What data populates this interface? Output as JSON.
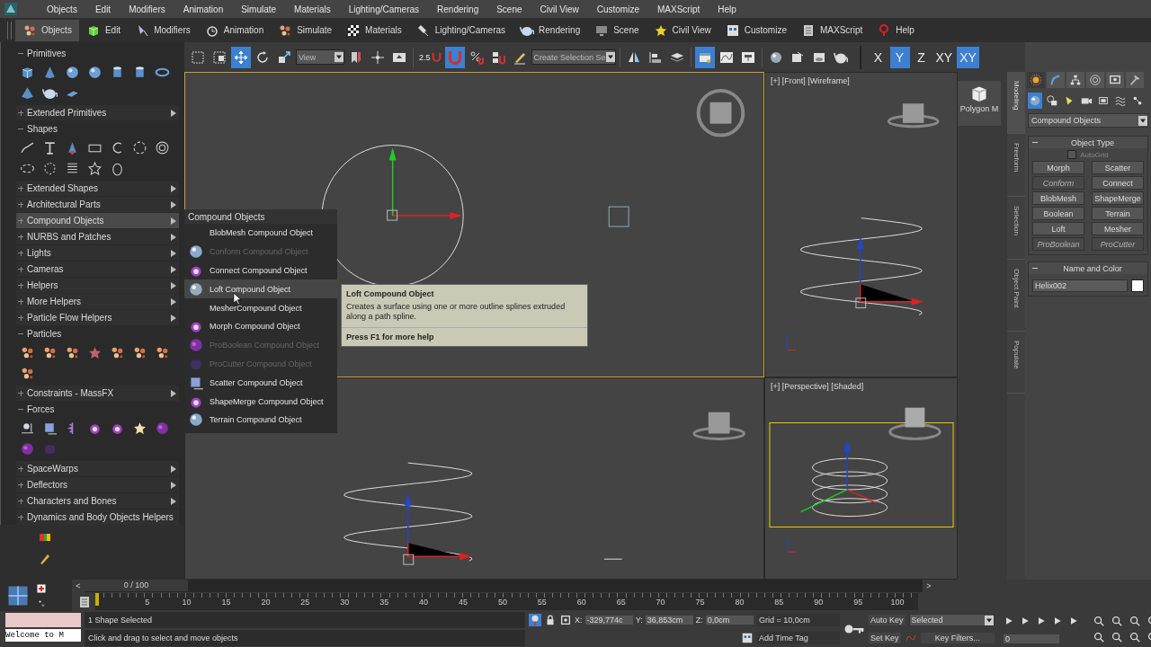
{
  "menu": [
    "Objects",
    "Edit",
    "Modifiers",
    "Animation",
    "Simulate",
    "Materials",
    "Lighting/Cameras",
    "Rendering",
    "Scene",
    "Civil View",
    "Customize",
    "MAXScript",
    "Help"
  ],
  "ribbon": [
    {
      "label": "Objects",
      "selected": true
    },
    {
      "label": "Edit",
      "selected": false
    },
    {
      "label": "Modifiers",
      "selected": false
    },
    {
      "label": "Animation",
      "selected": false
    },
    {
      "label": "Simulate",
      "selected": false
    },
    {
      "label": "Materials",
      "selected": false
    },
    {
      "label": "Lighting/Cameras",
      "selected": false
    },
    {
      "label": "Rendering",
      "selected": false
    },
    {
      "label": "Scene",
      "selected": false
    },
    {
      "label": "Civil View",
      "selected": false
    },
    {
      "label": "Customize",
      "selected": false
    },
    {
      "label": "MAXScript",
      "selected": false
    },
    {
      "label": "Help",
      "selected": false
    }
  ],
  "toolbar": {
    "view_dropdown": "View",
    "snap_label": "2.5",
    "selection_set": "Create Selection Se",
    "tools": [
      {
        "selected": false
      },
      {
        "selected": false
      },
      {
        "selected": true
      },
      {
        "selected": false
      },
      {
        "selected": false
      },
      {
        "selected": false
      },
      {
        "selected": false
      },
      {
        "selected": false
      },
      {
        "selected": false
      },
      {
        "selected": true
      },
      {
        "selected": false
      },
      {
        "selected": false
      },
      {
        "selected": false
      },
      {
        "selected": false
      },
      {
        "selected": false
      },
      {
        "selected": false
      },
      {
        "selected": true
      },
      {
        "selected": false
      },
      {
        "selected": false
      },
      {
        "selected": false
      },
      {
        "selected": false
      },
      {
        "selected": false
      },
      {
        "selected": false
      }
    ],
    "axes": [
      {
        "label": "X",
        "selected": false
      },
      {
        "label": "Y",
        "selected": true
      },
      {
        "label": "Z",
        "selected": false
      },
      {
        "label": "XY",
        "selected": false
      },
      {
        "label": "XY",
        "selected": true
      }
    ]
  },
  "create_panel": {
    "categories": [
      {
        "label": "Primitives",
        "expanded": true,
        "selected": false
      },
      {
        "label": "Extended Primitives",
        "expanded": false,
        "selected": false
      },
      {
        "label": "Shapes",
        "expanded": true,
        "selected": false
      },
      {
        "label": "Extended Shapes",
        "expanded": false,
        "selected": false
      },
      {
        "label": "Architectural Parts",
        "expanded": false,
        "selected": false
      },
      {
        "label": "Compound Objects",
        "expanded": false,
        "selected": true
      },
      {
        "label": "NURBS and Patches",
        "expanded": false,
        "selected": false
      },
      {
        "label": "Lights",
        "expanded": false,
        "selected": false
      },
      {
        "label": "Cameras",
        "expanded": false,
        "selected": false
      },
      {
        "label": "Helpers",
        "expanded": false,
        "selected": false
      },
      {
        "label": "More Helpers",
        "expanded": false,
        "selected": false
      },
      {
        "label": "Particle Flow Helpers",
        "expanded": false,
        "selected": false
      },
      {
        "label": "Particles",
        "expanded": true,
        "selected": false
      },
      {
        "label": "Constraints -  MassFX",
        "expanded": false,
        "selected": false
      },
      {
        "label": "Forces",
        "expanded": true,
        "selected": false
      },
      {
        "label": "SpaceWarps",
        "expanded": false,
        "selected": false
      },
      {
        "label": "Deflectors",
        "expanded": false,
        "selected": false
      },
      {
        "label": "Characters and Bones",
        "expanded": false,
        "selected": false
      },
      {
        "label": "Dynamics and Body Objects Helpers",
        "expanded": false,
        "selected": false
      }
    ]
  },
  "flyout": {
    "title": "Compound Objects",
    "items": [
      {
        "label": "BlobMesh Compound Object",
        "icon": false,
        "disabled": false,
        "selected": false
      },
      {
        "label": "Conform Compound Object",
        "icon": true,
        "disabled": true,
        "selected": false
      },
      {
        "label": "Connect Compound Object",
        "icon": true,
        "disabled": false,
        "selected": false
      },
      {
        "label": "Loft Compound Object",
        "icon": true,
        "disabled": false,
        "selected": true
      },
      {
        "label": "MesherCompound Object",
        "icon": false,
        "disabled": false,
        "selected": false
      },
      {
        "label": "Morph Compound Object",
        "icon": true,
        "disabled": false,
        "selected": false
      },
      {
        "label": "ProBoolean Compound Object",
        "icon": true,
        "disabled": true,
        "selected": false
      },
      {
        "label": "ProCutter Compound Object",
        "icon": true,
        "disabled": true,
        "selected": false
      },
      {
        "label": "Scatter Compound Object",
        "icon": true,
        "disabled": false,
        "selected": false
      },
      {
        "label": "ShapeMerge Compound Object",
        "icon": true,
        "disabled": false,
        "selected": false
      },
      {
        "label": "Terrain Compound Object",
        "icon": true,
        "disabled": false,
        "selected": false
      }
    ]
  },
  "tooltip": {
    "title": "Loft Compound Object",
    "text": "Creates a surface using one or more outline splines extruded along a path spline.",
    "help": "Press F1 for more help"
  },
  "viewports": [
    {
      "kind": "top",
      "active": true
    },
    {
      "kind": "front",
      "label": "[+] [Front] [Wireframe]",
      "active": false
    },
    {
      "kind": "left",
      "active": false
    },
    {
      "kind": "perspective",
      "label": "[+] [Perspective] [Shaded]",
      "active": false
    }
  ],
  "ribbon_strip": {
    "tool": "Polygon M",
    "tabs": [
      {
        "label": "Modeling",
        "selected": true
      },
      {
        "label": "Freeform",
        "selected": false
      },
      {
        "label": "Selection",
        "selected": false
      },
      {
        "label": "Object Paint",
        "selected": false
      },
      {
        "label": "Populate",
        "selected": false
      }
    ]
  },
  "command_panel": {
    "dropdown": "Compound Objects",
    "object_type": {
      "title": "Object Type",
      "autogrid": {
        "label": "AutoGrid",
        "checked": false,
        "disabled": true
      },
      "buttons": [
        {
          "label": "Morph",
          "disabled": false
        },
        {
          "label": "Scatter",
          "disabled": false
        },
        {
          "label": "Conform",
          "disabled": true
        },
        {
          "label": "Connect",
          "disabled": false
        },
        {
          "label": "BlobMesh",
          "disabled": false
        },
        {
          "label": "ShapeMerge",
          "disabled": false
        },
        {
          "label": "Boolean",
          "disabled": false
        },
        {
          "label": "Terrain",
          "disabled": false
        },
        {
          "label": "Loft",
          "disabled": false
        },
        {
          "label": "Mesher",
          "disabled": false
        },
        {
          "label": "ProBoolean",
          "disabled": true
        },
        {
          "label": "ProCutter",
          "disabled": true
        }
      ]
    },
    "name_and_color": {
      "title": "Name and Color",
      "name": "Helix002",
      "color": "#ffffff"
    }
  },
  "timeline": {
    "slider": "0 / 100",
    "prev": "<",
    "next": ">",
    "level": 0,
    "ticks": [
      "5",
      "10",
      "15",
      "20",
      "25",
      "30",
      "35",
      "40",
      "45",
      "50",
      "55",
      "60",
      "65",
      "70",
      "75",
      "80",
      "85",
      "90",
      "95",
      "100"
    ]
  },
  "status": {
    "script_listener": "Welcome to M",
    "selected": "1 Shape Selected",
    "prompt": "Click and drag to select and move objects",
    "coords": [
      {
        "label": "X:",
        "value": "-329,774c"
      },
      {
        "label": "Y:",
        "value": "36,853cm"
      },
      {
        "label": "Z:",
        "value": "0,0cm"
      }
    ],
    "grid": "Grid = 10,0cm",
    "add_time_tag": "Add Time Tag",
    "auto_key": "Auto Key",
    "key_mode": "Selected",
    "set_key": "Set Key",
    "key_filters": "Key Filters...",
    "frame": "0"
  }
}
